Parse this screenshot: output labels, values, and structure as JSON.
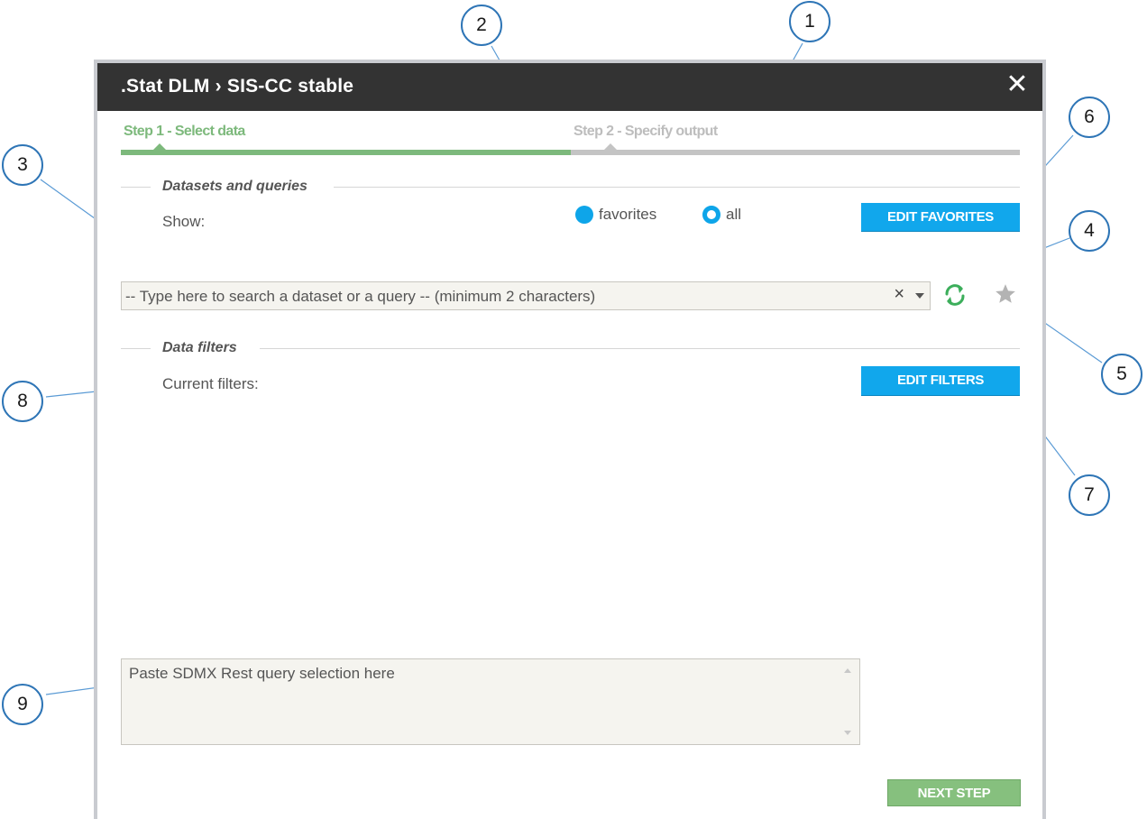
{
  "dialog": {
    "title": ".Stat DLM › SIS-CC stable",
    "close_glyph": "✕"
  },
  "steps": {
    "step1_label": "Step 1 - Select data",
    "step2_label": "Step 2 - Specify output",
    "active_color": "#7db97c",
    "inactive_color": "#c4c4c4"
  },
  "datasets": {
    "section_title": "Datasets and queries",
    "show_label": "Show:",
    "radio_favorites_label": "favorites",
    "radio_all_label": "all",
    "selected_option": "all",
    "edit_favorites_label": "EDIT FAVORITES",
    "search_placeholder": "-- Type here to search a dataset or a query --  (minimum 2 characters)",
    "clear_glyph": "×",
    "refresh_icon": "refresh-icon",
    "star_icon": "star-icon"
  },
  "filters": {
    "section_title": "Data filters",
    "current_filters_label": "Current filters:",
    "edit_filters_label": "EDIT FILTERS"
  },
  "sdmx": {
    "placeholder": "Paste SDMX Rest query selection here"
  },
  "footer": {
    "next_step_label": "NEXT STEP"
  },
  "callouts": [
    "1",
    "2",
    "3",
    "4",
    "5",
    "6",
    "7",
    "8",
    "9"
  ],
  "colors": {
    "accent_blue": "#11a7ec",
    "green": "#86c07e",
    "titlebar": "#333333",
    "callout_border": "#2e75b6"
  }
}
